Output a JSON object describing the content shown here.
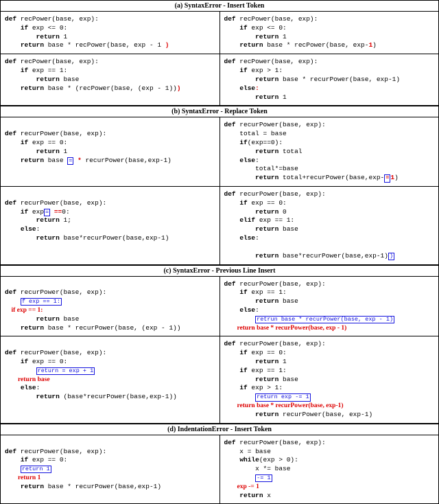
{
  "sections": {
    "a": {
      "title": "(a) SyntaxError - Insert Token"
    },
    "b": {
      "title": "(b) SyntaxError - Replace Token"
    },
    "c": {
      "title": "(c) SyntaxError - Previous Line Insert"
    },
    "d": {
      "title": "(d) IndentationError - Insert Token"
    }
  },
  "a": {
    "r1c1": {
      "l1": "def recPower(base, exp):",
      "l2": "    if exp <= 0:",
      "l3": "        return 1",
      "l4a": "    return base * recPower(base, exp - 1 ",
      "l4_ins": ")"
    },
    "r1c2": {
      "l1": "def recPower(base, exp):",
      "l2": "    if exp <= 0:",
      "l3": "        return 1",
      "l4a": "    return base * recPower(base, exp-",
      "l4_ins": "1",
      "l4b": ")"
    },
    "r2c1": {
      "l1": "def recPower(base, exp):",
      "l2": "    if exp == 1:",
      "l3": "        return base",
      "l4a": "    return base * (recPower(base, (exp - 1))",
      "l4_ins": ")"
    },
    "r2c2": {
      "l1": "def recPower(base, exp):",
      "l2": "    if exp > 1:",
      "l3": "        return base * recurPower(base, exp-1)",
      "l4": "    else",
      "l4_ins": ":",
      "l5": "        return 1"
    }
  },
  "b": {
    "r1c1": {
      "l1": "def recurPower(base, exp):",
      "l2": "    if exp == 0:",
      "l3": "        return 1",
      "l4a": "    return base ",
      "box": "=",
      "star": "*",
      "l4b": " recurPower(base,exp-1)"
    },
    "r1c2": {
      "l1": "def recurPower(base, exp):",
      "l2": "    total = base",
      "l3": "    if(exp==0):",
      "l4": "        return total",
      "l5": "    else:",
      "l6": "        total*=base",
      "l7a": "        return total+recurPower(base,exp-",
      "box": "=",
      "rep": "1",
      "l7b": ")"
    },
    "r2c1": {
      "l1": "def recurPower(base, exp):",
      "l2a": "    if exp",
      "box": "=",
      "rep": "==",
      "l2b": "0:",
      "l3": "        return 1;",
      "l4": "    else:",
      "l5": "        return base*recurPower(base,exp-1)"
    },
    "r2c2": {
      "l1": "def recurPower(base, exp):",
      "l2": "    if exp == 0:",
      "l3": "        return 0",
      "l4": "    elif exp == 1:",
      "l5": "        return base",
      "l6": "    else:",
      "l7a": "        return base*recurPower(base,exp-1)",
      "box": ")"
    }
  },
  "c": {
    "r1c1": {
      "l1": "def recurPower(base, exp):",
      "box": "f exp == 1:",
      "ins": "    if exp == 1:",
      "l3": "        return base",
      "l4": "    return base * recurPower(base, (exp - 1))"
    },
    "r1c2": {
      "l1": "def recurPower(base, exp):",
      "l2": "    if exp == 1:",
      "l3": "        return base",
      "l4": "    else:",
      "box": "retrun base * recurPower(base, exp - 1)",
      "ins": "        return base * recurPower(base, exp - 1)"
    },
    "r2c1": {
      "l1": "def recurPower(base, exp):",
      "l2": "    if exp == 0:",
      "box": "return = exp + 1",
      "ins": "        return base",
      "l4": "    else:",
      "l5": "        return (base*recurPower(base,exp-1))"
    },
    "r2c2": {
      "l1": "def recurPower(base, exp):",
      "l2": "    if exp == 0:",
      "l3": "        return 1",
      "l4": "    if exp == 1:",
      "l5": "        return base",
      "l6": "    if exp > 1:",
      "box": "return exp -= 1",
      "ins": "        return base * recurPower(base, exp-1)",
      "l8": "        return recurPower(base, exp-1)"
    }
  },
  "d": {
    "r1c1": {
      "l1": "def recurPower(base, exp):",
      "l2": "    if exp == 0:",
      "box": "return 1",
      "ins": "        return 1",
      "l4": "    return base * recurPower(base,exp-1)"
    },
    "r1c2": {
      "l1": "def recurPower(base, exp):",
      "l2": "    x = base",
      "l3": "    while(exp > 0):",
      "l4": "        x *= base",
      "box": "-= 1",
      "ins": "        exp -= 1",
      "l6": "    return x"
    }
  }
}
